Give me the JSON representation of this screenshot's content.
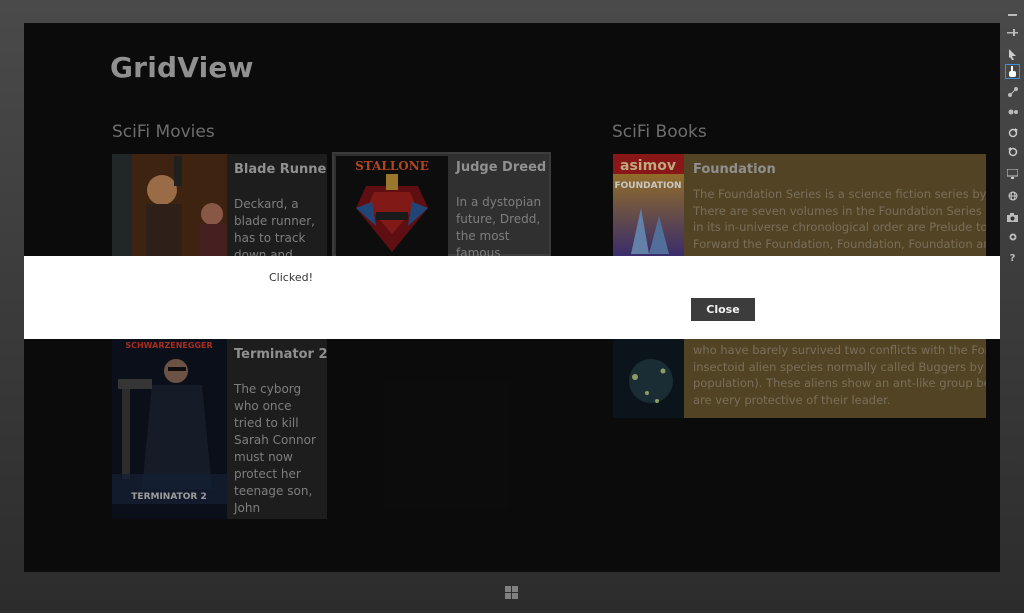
{
  "app": {
    "title": "GridView"
  },
  "groups": [
    {
      "title": "SciFi Movies",
      "items": [
        {
          "title": "Blade Runner",
          "description": "Deckard, a blade runner, has to track down and"
        },
        {
          "title": "Judge Dreed",
          "description": "In a dystopian future, Dredd, the most famous"
        },
        {
          "title": "Terminator 2",
          "description": "The cyborg who once tried to kill Sarah Connor must now protect her teenage son, John Connor,..."
        }
      ]
    },
    {
      "title": "SciFi Books",
      "items": [
        {
          "title": "Foundation",
          "description_lines": [
            "The Foundation Series is a science fiction series by Isaac",
            "There are seven volumes in the Foundation Series prop",
            "in its in-universe chronological order are Prelude to Fou",
            "Forward the Foundation, Foundation, Foundation and I"
          ],
          "cover_brand": "asimov",
          "cover_title": "FOUNDATION"
        },
        {
          "title": "",
          "description_lines": [
            "who have barely survived two conflicts with the Formic",
            "insectoid alien species normally called Buggers by most",
            "population). These aliens show an ant-like group behav",
            "are very protective of their leader."
          ]
        }
      ]
    }
  ],
  "posters": {
    "judge_dredd_top": "STALLONE",
    "terminator_top": "SCHWARZENEGGER",
    "terminator_bottom": "TERMINATOR 2"
  },
  "dialog": {
    "message": "Clicked!",
    "close_label": "Close"
  },
  "toolbar": {
    "icons": [
      "minimize-icon",
      "pin-icon",
      "pointer-icon",
      "hand-icon",
      "pinch-icon",
      "rotate-icon",
      "rotate-cw-icon",
      "rotate-ccw-icon",
      "monitor-icon",
      "globe-icon",
      "camera-icon",
      "settings-icon",
      "help-icon"
    ],
    "help_glyph": "?"
  },
  "colors": {
    "book_tile": "#6b5630",
    "dialog_bg": "#ffffff",
    "close_button": "#3c3c3c",
    "toolbar_active": "#3d8fd6"
  }
}
